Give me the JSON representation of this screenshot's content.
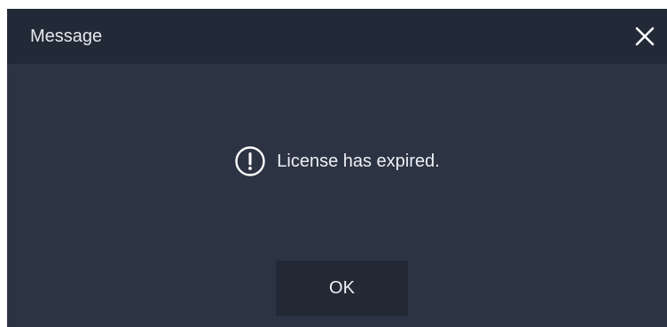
{
  "dialog": {
    "title": "Message",
    "message": "License has expired.",
    "ok_label": "OK"
  },
  "icons": {
    "close": "close-icon",
    "message": "exclamation-circle-icon"
  },
  "colors": {
    "titlebar_bg": "#222a37",
    "dialog_bg": "#2c3444",
    "button_bg": "#232a36",
    "text": "#eef1f5"
  }
}
